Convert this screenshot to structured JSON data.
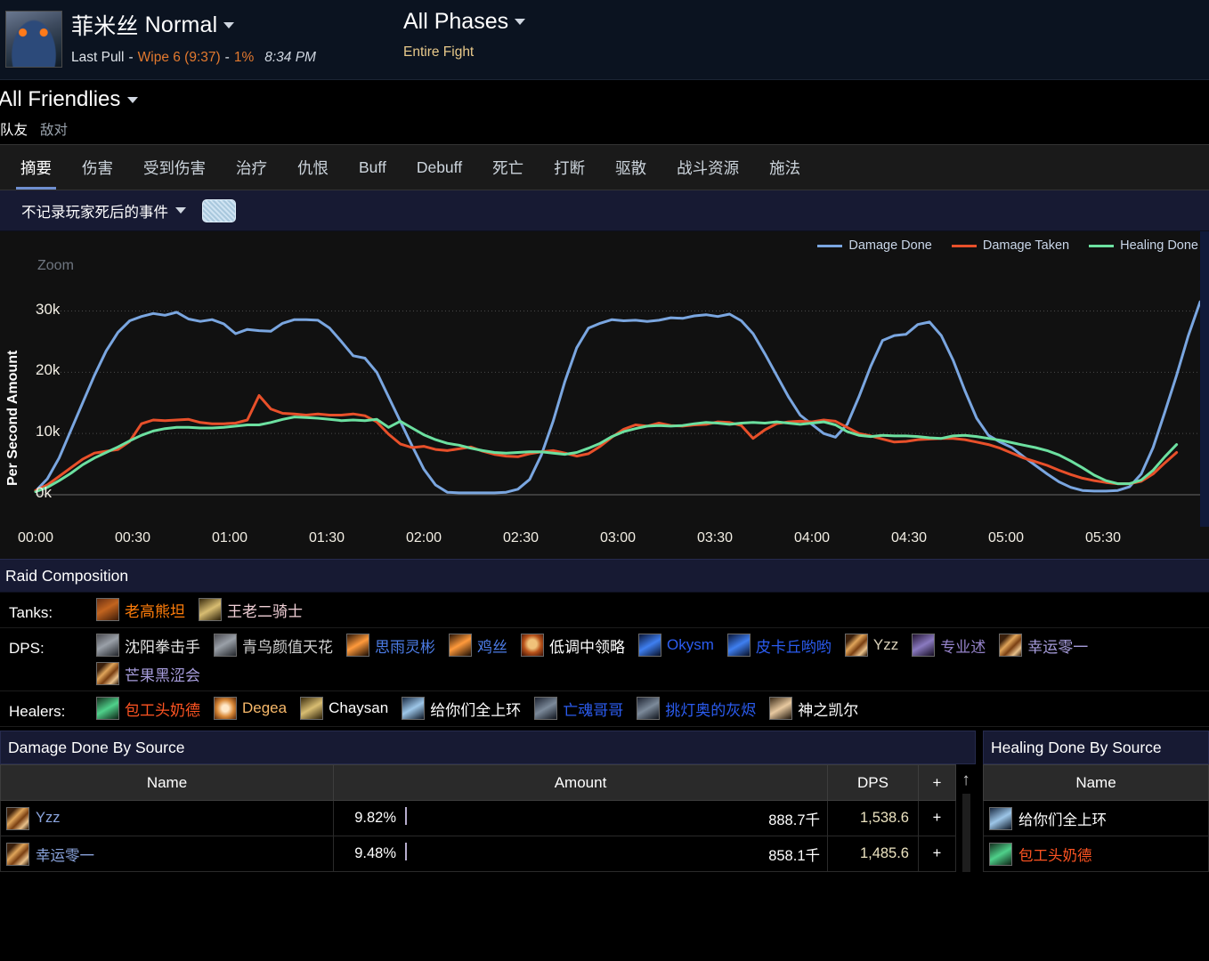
{
  "header": {
    "boss_icon": "boss-portrait-icon",
    "title_cn": "菲米丝",
    "title_difficulty": "Normal",
    "pull_label": "Last Pull",
    "dash1": "-",
    "wipe": "Wipe 6 (9:37)",
    "dash2": "-",
    "percent": "1%",
    "time": "8:34 PM",
    "phase_title": "All Phases",
    "phase_sub": "Entire Fight"
  },
  "friendlies": {
    "title": "All Friendlies",
    "toggle_on": "队友",
    "toggle_off": "敌对"
  },
  "tabs": [
    {
      "label": "摘要",
      "active": true
    },
    {
      "label": "伤害",
      "active": false
    },
    {
      "label": "受到伤害",
      "active": false
    },
    {
      "label": "治疗",
      "active": false
    },
    {
      "label": "仇恨",
      "active": false
    },
    {
      "label": "Buff",
      "active": false
    },
    {
      "label": "Debuff",
      "active": false
    },
    {
      "label": "死亡",
      "active": false
    },
    {
      "label": "打断",
      "active": false
    },
    {
      "label": "驱散",
      "active": false
    },
    {
      "label": "战斗资源",
      "active": false
    },
    {
      "label": "施法",
      "active": false
    }
  ],
  "filterbar": {
    "dropdown_label": "不记录玩家死后的事件",
    "chip": "thumbnail-chip"
  },
  "chart_data": {
    "type": "line",
    "title": "",
    "zoom_label": "Zoom",
    "ylabel": "Per Second Amount",
    "xlabel": "",
    "ylim": [
      0,
      34000
    ],
    "yticks": [
      "0k",
      "10k",
      "20k",
      "30k"
    ],
    "ytick_values": [
      0,
      10000,
      20000,
      30000
    ],
    "grid": true,
    "legend_position": "top-right",
    "xticks": [
      "00:00",
      "00:30",
      "01:00",
      "01:30",
      "02:00",
      "02:30",
      "03:00",
      "03:30",
      "04:00",
      "04:30",
      "05:00",
      "05:30"
    ],
    "x_seconds": [
      0,
      30,
      60,
      90,
      120,
      150,
      180,
      210,
      240,
      270,
      300,
      330
    ],
    "x_range_seconds": [
      0,
      360
    ],
    "series": [
      {
        "name": "Damage Done",
        "color": "#7aa6e0",
        "values": [
          600,
          2600,
          6000,
          10500,
          15000,
          19500,
          23500,
          26500,
          28400,
          29100,
          29600,
          29300,
          29800,
          28700,
          28300,
          28600,
          27900,
          26300,
          27000,
          26800,
          26700,
          28000,
          28600,
          28600,
          28500,
          27200,
          25000,
          22700,
          22300,
          20000,
          16000,
          12000,
          8000,
          4200,
          1600,
          400,
          300,
          300,
          300,
          300,
          400,
          900,
          2500,
          6500,
          12000,
          18500,
          24000,
          27200,
          28000,
          28600,
          28400,
          28500,
          28300,
          28500,
          28900,
          28800,
          29200,
          29400,
          29100,
          29500,
          28400,
          26300,
          23000,
          19500,
          16000,
          13000,
          11500,
          10000,
          9400,
          11500,
          16000,
          21000,
          25200,
          26000,
          26200,
          27800,
          28200,
          26000,
          22000,
          17000,
          12500,
          9700,
          8600,
          7700,
          6200,
          4800,
          3400,
          2100,
          1200,
          700,
          600,
          600,
          700,
          1300,
          3400,
          7700,
          13500,
          19500,
          26000,
          31500
        ]
      },
      {
        "name": "Damage Taken",
        "color": "#e8502a",
        "values": [
          700,
          1600,
          3000,
          4400,
          5800,
          6800,
          7100,
          7400,
          8700,
          11600,
          12200,
          12100,
          12200,
          12300,
          11800,
          11600,
          11600,
          11700,
          12200,
          16200,
          14000,
          13300,
          13200,
          13000,
          13200,
          13000,
          13000,
          13200,
          12900,
          11900,
          9900,
          8300,
          7700,
          7900,
          7400,
          7200,
          7500,
          7800,
          7100,
          6600,
          6300,
          6200,
          6700,
          7000,
          7200,
          6800,
          6300,
          6700,
          7900,
          9400,
          10700,
          11400,
          11200,
          11700,
          11300,
          11200,
          11400,
          11500,
          11900,
          11800,
          11300,
          9200,
          10600,
          11600,
          11900,
          12000,
          11900,
          12200,
          12000,
          11000,
          10000,
          9600,
          9100,
          8600,
          8700,
          9000,
          9100,
          9200,
          9200,
          9000,
          8600,
          8200,
          7600,
          6800,
          6000,
          5400,
          4800,
          4000,
          3300,
          2700,
          2300,
          2000,
          1800,
          1800,
          2200,
          3400,
          5200,
          6900
        ]
      },
      {
        "name": "Healing Done",
        "color": "#6ce0a0",
        "values": [
          500,
          1200,
          2300,
          3500,
          4900,
          6000,
          6900,
          7800,
          8800,
          9700,
          10400,
          10800,
          11000,
          11000,
          10900,
          10900,
          11000,
          11200,
          11400,
          11400,
          11800,
          12300,
          12700,
          12600,
          12500,
          12300,
          12100,
          12200,
          12100,
          12300,
          11000,
          12000,
          10900,
          9800,
          9000,
          8400,
          8100,
          7600,
          7200,
          6900,
          6800,
          6900,
          7000,
          7000,
          6800,
          6600,
          6900,
          7600,
          8400,
          9500,
          10300,
          10800,
          11200,
          11300,
          11200,
          11300,
          11600,
          11800,
          11700,
          11500,
          11700,
          11800,
          11700,
          11900,
          11700,
          11500,
          11700,
          11900,
          11400,
          10300,
          9700,
          9500,
          9700,
          9600,
          9600,
          9500,
          9300,
          9200,
          9600,
          9700,
          9500,
          9200,
          8900,
          8500,
          8100,
          7700,
          7200,
          6500,
          5500,
          4400,
          3200,
          2300,
          1800,
          1800,
          2400,
          4000,
          6200,
          8200
        ]
      }
    ]
  },
  "raid": {
    "section_title": "Raid Composition",
    "rows": [
      {
        "label": "Tanks:",
        "members": [
          {
            "name": "老高熊坦",
            "color": "#ff7d0a",
            "icon": "class-icon-druid"
          },
          {
            "name": "王老二骑士",
            "color": "#f0cfd6",
            "icon": "class-icon-paladin"
          }
        ]
      },
      {
        "label": "DPS:",
        "members": [
          {
            "name": "沈阳拳击手",
            "color": "#e4e4e4",
            "icon": "class-icon-warrior"
          },
          {
            "name": "青鸟颜值天花",
            "color": "#cfcfcf",
            "icon": "class-icon-warrior"
          },
          {
            "name": "思雨灵彬",
            "color": "#4c7ce6",
            "icon": "class-icon-hunter"
          },
          {
            "name": "鸡丝",
            "color": "#4c7ce6",
            "icon": "class-icon-hunter"
          },
          {
            "name": "低调中领略",
            "color": "#ffffff",
            "icon": "class-icon-warlock-skull"
          },
          {
            "name": "Okysm",
            "color": "#2b5cf0",
            "icon": "class-icon-shaman"
          },
          {
            "name": "皮卡丘哟哟",
            "color": "#2b5cf0",
            "icon": "class-icon-shaman"
          },
          {
            "name": "Yzz",
            "color": "#d8cfb8",
            "icon": "class-icon-rogue"
          },
          {
            "name": "专业述",
            "color": "#9482c9",
            "icon": "class-icon-warlock"
          },
          {
            "name": "幸运零一",
            "color": "#a79ddc",
            "icon": "class-icon-rogue"
          },
          {
            "name": "芒果黑涩会",
            "color": "#a79ddc",
            "icon": "class-icon-rogue"
          }
        ]
      },
      {
        "label": "Healers:",
        "members": [
          {
            "name": "包工头奶德",
            "color": "#ff5422",
            "icon": "class-icon-druid-resto"
          },
          {
            "name": "Degea",
            "color": "#f8b96a",
            "icon": "class-icon-priest-disc"
          },
          {
            "name": "Chaysan",
            "color": "#ffffff",
            "icon": "class-icon-paladin"
          },
          {
            "name": "给你们全上环",
            "color": "#ffffff",
            "icon": "class-icon-priest"
          },
          {
            "name": "亡魂哥哥",
            "color": "#2b5cf0",
            "icon": "class-icon-shaman-resto"
          },
          {
            "name": "挑灯奥的灰烬",
            "color": "#2b5cf0",
            "icon": "class-icon-shaman-resto"
          },
          {
            "name": "神之凯尔",
            "color": "#ffffff",
            "icon": "class-icon-priest-holy"
          }
        ]
      }
    ]
  },
  "damage_panel": {
    "title": "Damage Done By Source",
    "columns": [
      "Name",
      "Amount",
      "DPS",
      "+"
    ],
    "rows": [
      {
        "name": "Yzz",
        "color": "#8aa4dd",
        "icon": "class-icon-rogue",
        "percent": "9.82%",
        "bar_pct": 98.2,
        "amount": "888.7千",
        "dps": "1,538.6",
        "plus": "+"
      },
      {
        "name": "幸运零一",
        "color": "#8aa4dd",
        "icon": "class-icon-rogue",
        "percent": "9.48%",
        "bar_pct": 94.8,
        "amount": "858.1千",
        "dps": "1,485.6",
        "plus": "+"
      }
    ]
  },
  "healing_panel": {
    "title": "Healing Done By Source",
    "columns": [
      "Name"
    ],
    "rows": [
      {
        "name": "给你们全上环",
        "color": "#ffffff",
        "icon": "class-icon-priest"
      },
      {
        "name": "包工头奶德",
        "color": "#ff5422",
        "icon": "class-icon-druid-resto"
      }
    ]
  }
}
